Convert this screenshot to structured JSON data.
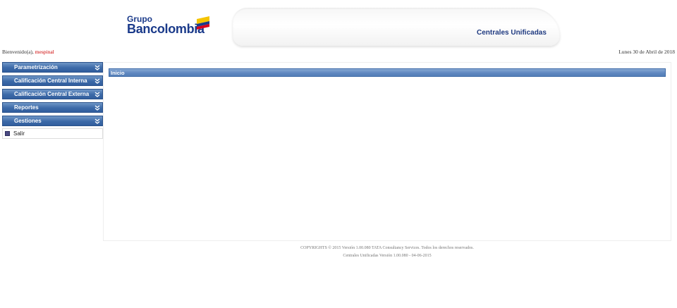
{
  "header": {
    "logo_line1": "Grupo",
    "logo_line2": "Bancolombia",
    "app_title": "Centrales Unificadas"
  },
  "welcome": {
    "prefix": "Bienvenido(a),",
    "username": "mespinal",
    "date": "Lunes 30 de Abril de 2018"
  },
  "sidebar": {
    "items": [
      {
        "label": "Parametrización"
      },
      {
        "label": "Calificación Central Interna"
      },
      {
        "label": "Calificación Central Externa"
      },
      {
        "label": "Reportes"
      },
      {
        "label": "Gestiones"
      }
    ],
    "salir_label": "Salir"
  },
  "main": {
    "section_title": "Inicio"
  },
  "footer": {
    "line1": "COPYRIGHTS © 2015 Versión 1.00.080 TATA Consultancy Services. Todos los derechos reservados.",
    "line2": "Centrales Unificadas Versión 1.00.080 - 04-06-2015"
  },
  "colors": {
    "menu_blue": "#3c6aa8",
    "brand_navy": "#1a3a8a",
    "username_red": "#cc0000",
    "flag_yellow": "#f5c400",
    "flag_red": "#d6001c"
  }
}
